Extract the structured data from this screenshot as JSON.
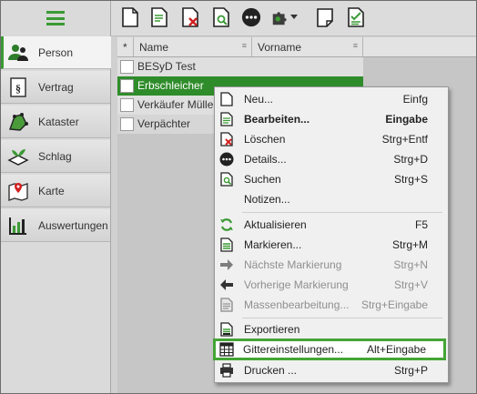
{
  "sidebar": {
    "menu_icon": "hamburger-icon",
    "items": [
      {
        "label": "Person",
        "icon": "person-icon",
        "active": true
      },
      {
        "label": "Vertrag",
        "icon": "contract-icon"
      },
      {
        "label": "Kataster",
        "icon": "cadastre-icon"
      },
      {
        "label": "Schlag",
        "icon": "field-icon"
      },
      {
        "label": "Karte",
        "icon": "map-icon"
      },
      {
        "label": "Auswertungen",
        "icon": "chart-icon"
      }
    ]
  },
  "toolbar": {
    "icons": [
      "new-document-icon",
      "edit-document-icon",
      "delete-document-icon",
      "search-document-icon",
      "more-icon",
      "plugin-icon",
      "dropdown-arrow-icon",
      "note-icon",
      "mark-document-icon"
    ]
  },
  "grid": {
    "columns": [
      {
        "label": "*"
      },
      {
        "label": "Name"
      },
      {
        "label": "Vorname"
      }
    ],
    "rows": [
      {
        "name": "BESyD Test",
        "state": "alt"
      },
      {
        "name": "Erbschleicher",
        "state": "selected"
      },
      {
        "name": "Verkäufer Müller",
        "state": "alt"
      },
      {
        "name": "Verpächter",
        "state": "normal"
      }
    ]
  },
  "context_menu": {
    "items": [
      {
        "label": "Neu...",
        "shortcut": "Einfg",
        "icon": "new-icon"
      },
      {
        "label": "Bearbeiten...",
        "shortcut": "Eingabe",
        "icon": "edit-icon",
        "bold": true
      },
      {
        "label": "Löschen",
        "shortcut": "Strg+Entf",
        "icon": "delete-icon"
      },
      {
        "label": "Details...",
        "shortcut": "Strg+D",
        "icon": "details-icon"
      },
      {
        "label": "Suchen",
        "shortcut": "Strg+S",
        "icon": "search-icon"
      },
      {
        "label": "Notizen...",
        "shortcut": "",
        "icon": "notes-icon"
      },
      {
        "label": "Aktualisieren",
        "shortcut": "F5",
        "icon": "refresh-icon"
      },
      {
        "label": "Markieren...",
        "shortcut": "Strg+M",
        "icon": "mark-icon"
      },
      {
        "label": "Nächste Markierung",
        "shortcut": "Strg+N",
        "icon": "next-arrow-icon",
        "disabled": true
      },
      {
        "label": "Vorherige Markierung",
        "shortcut": "Strg+V",
        "icon": "prev-arrow-icon",
        "disabled": true
      },
      {
        "label": "Massenbearbeitung...",
        "shortcut": "Strg+Eingabe",
        "icon": "bulk-edit-icon",
        "disabled": true
      },
      {
        "label": "Exportieren",
        "shortcut": "",
        "icon": "export-icon"
      },
      {
        "label": "Gittereinstellungen...",
        "shortcut": "Alt+Eingabe",
        "icon": "grid-settings-icon",
        "highlighted": true
      },
      {
        "label": "Drucken ...",
        "shortcut": "Strg+P",
        "icon": "print-icon"
      }
    ]
  },
  "colors": {
    "accent": "#3a9a34",
    "selection": "#2f8c2a"
  }
}
